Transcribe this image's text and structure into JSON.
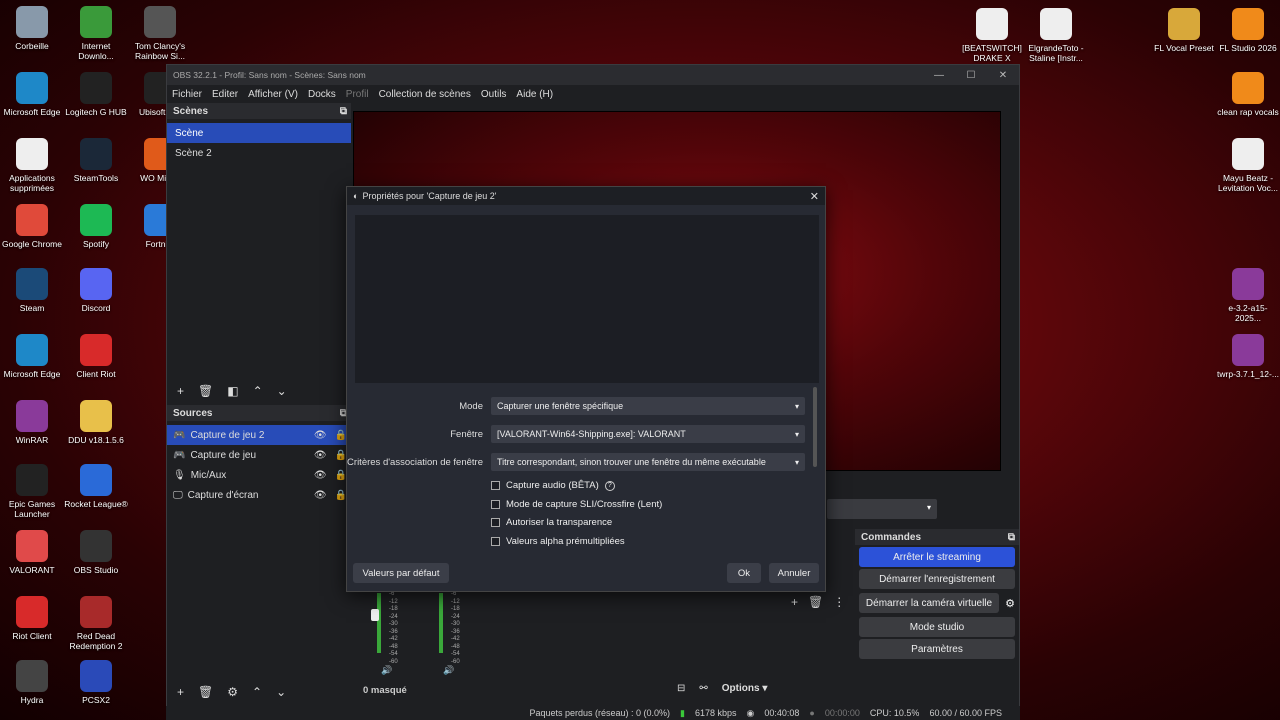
{
  "desktop_left": [
    {
      "label": "Corbeille",
      "icon": "recycle-bin-icon",
      "color": "#8899aa",
      "x": 0,
      "y": 0
    },
    {
      "label": "Internet Downlo...",
      "icon": "internet-download-icon",
      "color": "#3a9a3a"
    },
    {
      "label": "Tom Clancy's Rainbow Si...",
      "icon": "rainbow-six-icon",
      "color": "#555"
    },
    {
      "label": "Microsoft Edge",
      "icon": "edge-icon",
      "color": "#1e88c8"
    },
    {
      "label": "Logitech G HUB",
      "icon": "logitech-icon",
      "color": "#222"
    },
    {
      "label": "Ubisoft C...",
      "icon": "ubisoft-icon",
      "color": "#222"
    },
    {
      "label": "Applications supprimées",
      "icon": "chrome-app-icon",
      "color": "#eee"
    },
    {
      "label": "SteamTools",
      "icon": "steam-icon",
      "color": "#1b2838"
    },
    {
      "label": "WO Mic ...",
      "icon": "mic-icon",
      "color": "#e05a1a"
    },
    {
      "label": "Google Chrome",
      "icon": "chrome-icon",
      "color": "#e04a3a"
    },
    {
      "label": "Spotify",
      "icon": "spotify-icon",
      "color": "#1db954"
    },
    {
      "label": "Fortni...",
      "icon": "fortnite-icon",
      "color": "#2a7ad8"
    },
    {
      "label": "Steam",
      "icon": "steam-icon",
      "color": "#1b4a78"
    },
    {
      "label": "Discord",
      "icon": "discord-icon",
      "color": "#5865f2"
    },
    {
      "label": "Microsoft Edge",
      "icon": "edge-icon",
      "color": "#1e88c8"
    },
    {
      "label": "Client Riot",
      "icon": "riot-icon",
      "color": "#d82a2a"
    },
    {
      "label": "WinRAR",
      "icon": "winrar-icon",
      "color": "#8a3a9a"
    },
    {
      "label": "DDU v18.1.5.6",
      "icon": "folder-icon",
      "color": "#e8c04a"
    },
    {
      "label": "Epic Games Launcher",
      "icon": "epic-icon",
      "color": "#222"
    },
    {
      "label": "Rocket League®",
      "icon": "rocket-league-icon",
      "color": "#2a6ad8"
    },
    {
      "label": "VALORANT",
      "icon": "valorant-icon",
      "color": "#e04a4a"
    },
    {
      "label": "OBS Studio",
      "icon": "obs-icon",
      "color": "#333"
    },
    {
      "label": "Riot Client",
      "icon": "riot-icon",
      "color": "#d82a2a"
    },
    {
      "label": "Red Dead Redemption 2",
      "icon": "rdr2-icon",
      "color": "#a82a2a"
    },
    {
      "label": "Hydra",
      "icon": "hydra-icon",
      "color": "#444"
    },
    {
      "label": "PCSX2",
      "icon": "pcsx2-icon",
      "color": "#2a4ab8"
    }
  ],
  "desktop_right": [
    {
      "label": "[BEATSWITCH] DRAKE X TRAVI...",
      "icon": "media-file-icon",
      "color": "#eee"
    },
    {
      "label": "ElgrandeToto - Staline [Instr...",
      "icon": "media-file-icon",
      "color": "#eee"
    },
    {
      "label": "FL Vocal Preset",
      "icon": "winrar-archive-icon",
      "color": "#d8a83a"
    },
    {
      "label": "FL Studio 2026",
      "icon": "fl-studio-icon",
      "color": "#f08a1a"
    },
    {
      "label": "clean rap vocals",
      "icon": "fl-studio-icon",
      "color": "#f08a1a"
    },
    {
      "label": "Mayu Beatz - Levitation Voc...",
      "icon": "pdf-icon",
      "color": "#eee"
    },
    {
      "label": "e-3.2-a15-2025...",
      "icon": "winrar-archive-icon",
      "color": "#8a3a9a"
    },
    {
      "label": "twrp-3.7.1_12-...",
      "icon": "winrar-archive-icon",
      "color": "#8a3a9a"
    }
  ],
  "obs": {
    "title": "OBS 32.2.1 - Profil: Sans nom - Scènes: Sans nom",
    "menu": [
      "Fichier",
      "Editer",
      "Afficher (V)",
      "Docks",
      "Profil",
      "Collection de scènes",
      "Outils",
      "Aide (H)"
    ],
    "scenes_header": "Scènes",
    "scenes": [
      "Scène",
      "Scène 2"
    ],
    "sources_header": "Sources",
    "sources": [
      "Capture de jeu 2",
      "Capture de jeu",
      "Mic/Aux",
      "Capture d'écran"
    ],
    "commands_header": "Commandes",
    "commands": [
      "Arrêter le streaming",
      "Démarrer l'enregistrement",
      "Démarrer la caméra virtuelle",
      "Mode studio",
      "Paramètres"
    ],
    "hidden_count": "0 masqué",
    "options_label": "Options",
    "meter_ticks": [
      "-6",
      "-12",
      "-18",
      "-24",
      "-30",
      "-36",
      "-42",
      "-48",
      "-54",
      "-60"
    ]
  },
  "dialog": {
    "title": "Propriétés pour 'Capture de jeu 2'",
    "mode_label": "Mode",
    "mode_value": "Capturer une fenêtre spécifique",
    "window_label": "Fenêtre",
    "window_value": "[VALORANT-Win64-Shipping.exe]: VALORANT",
    "match_label": "Critères d'association de fenêtre",
    "match_value": "Titre correspondant, sinon trouver une fenêtre du même exécutable",
    "checkboxes": [
      "Capture audio (BÊTA)",
      "Mode de capture SLI/Crossfire (Lent)",
      "Autoriser la transparence",
      "Valeurs alpha prémultipliées"
    ],
    "defaults_button": "Valeurs par défaut",
    "ok_button": "Ok",
    "cancel_button": "Annuler"
  },
  "status": {
    "dropped": "Paquets perdus (réseau) : 0 (0.0%)",
    "bitrate": "6178 kbps",
    "stream_time": "00:40:08",
    "rec_time": "00:00:00",
    "cpu": "CPU: 10.5%",
    "fps": "60.00 / 60.00 FPS"
  }
}
